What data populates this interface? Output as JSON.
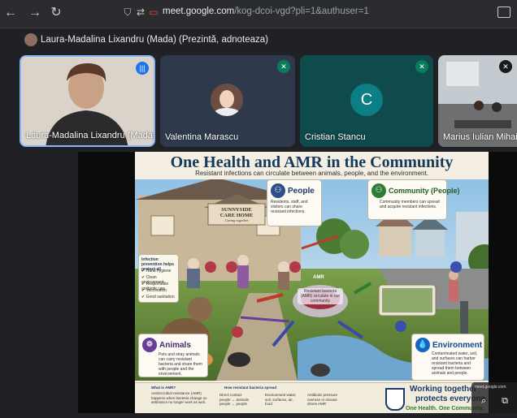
{
  "browser": {
    "back": "←",
    "forward": "→",
    "reload": "↻",
    "url_host": "meet.google.com",
    "url_path": "/kog-dcoi-vgd?pli=1&authuser=1"
  },
  "banner": {
    "presenter_label": "Laura-Madalina Lixandru (Mada) (Prezintă, adnoteaza)"
  },
  "tiles": [
    {
      "name": "Laura-Madalina Lixandru (Mada)"
    },
    {
      "name": "Valentina Marascu"
    },
    {
      "name": "Cristian Stancu",
      "initial": "C"
    },
    {
      "name": "Marius Iulian Mihailescu"
    }
  ],
  "slide": {
    "title": "One Health and AMR in the Community",
    "subtitle": "Resistant infections can circulate between animals, people, and the environment.",
    "sign_line1": "SUNNYSIDE",
    "sign_line2": "CARE HOME",
    "sign_line3": "Caring together",
    "people_title": "People",
    "people_text": "Residents, staff, and visitors can share resistant infections.",
    "community_title": "Community (People)",
    "community_text": "Community members can spread and acquire resistant infections.",
    "animals_title": "Animals",
    "animals_text": "Pets and stray animals can carry resistant bacteria and share them with people and the environment.",
    "environment_title": "Environment",
    "environment_text": "Contaminated water, soil, and surfaces can harbor resistant bacteria and spread them between animals and people.",
    "infection_title": "Infection prevention helps protect all",
    "infection_items": [
      "Hand hygiene",
      "Clean environment",
      "Responsible antibiotic use",
      "Vaccination",
      "Good sanitation"
    ],
    "center_label": "Resistant bacteria (AMR) circulate in our community",
    "what_is_amr_title": "What is AMR?",
    "what_is_amr_text": "Antimicrobial resistance (AMR) happens when bacteria change so antibiotics no longer work as well.",
    "spread_title": "How resistant bacteria spread",
    "spread_items": [
      "Direct contact people ↔ animals people ↔ people",
      "Environment water, soil, surfaces, air, food",
      "Antibiotic pressure overuse or misuse drives AMR"
    ],
    "cta_line1": "Working together",
    "cta_line2": "protects everyone.",
    "cta_line3": "One Health. One Community.",
    "amr_label": "AMR"
  },
  "overlay": {
    "text": "meet.google.com"
  },
  "colors": {
    "title": "#153a5c",
    "green": "#2e7d32",
    "speaking": "#1a73e8"
  }
}
